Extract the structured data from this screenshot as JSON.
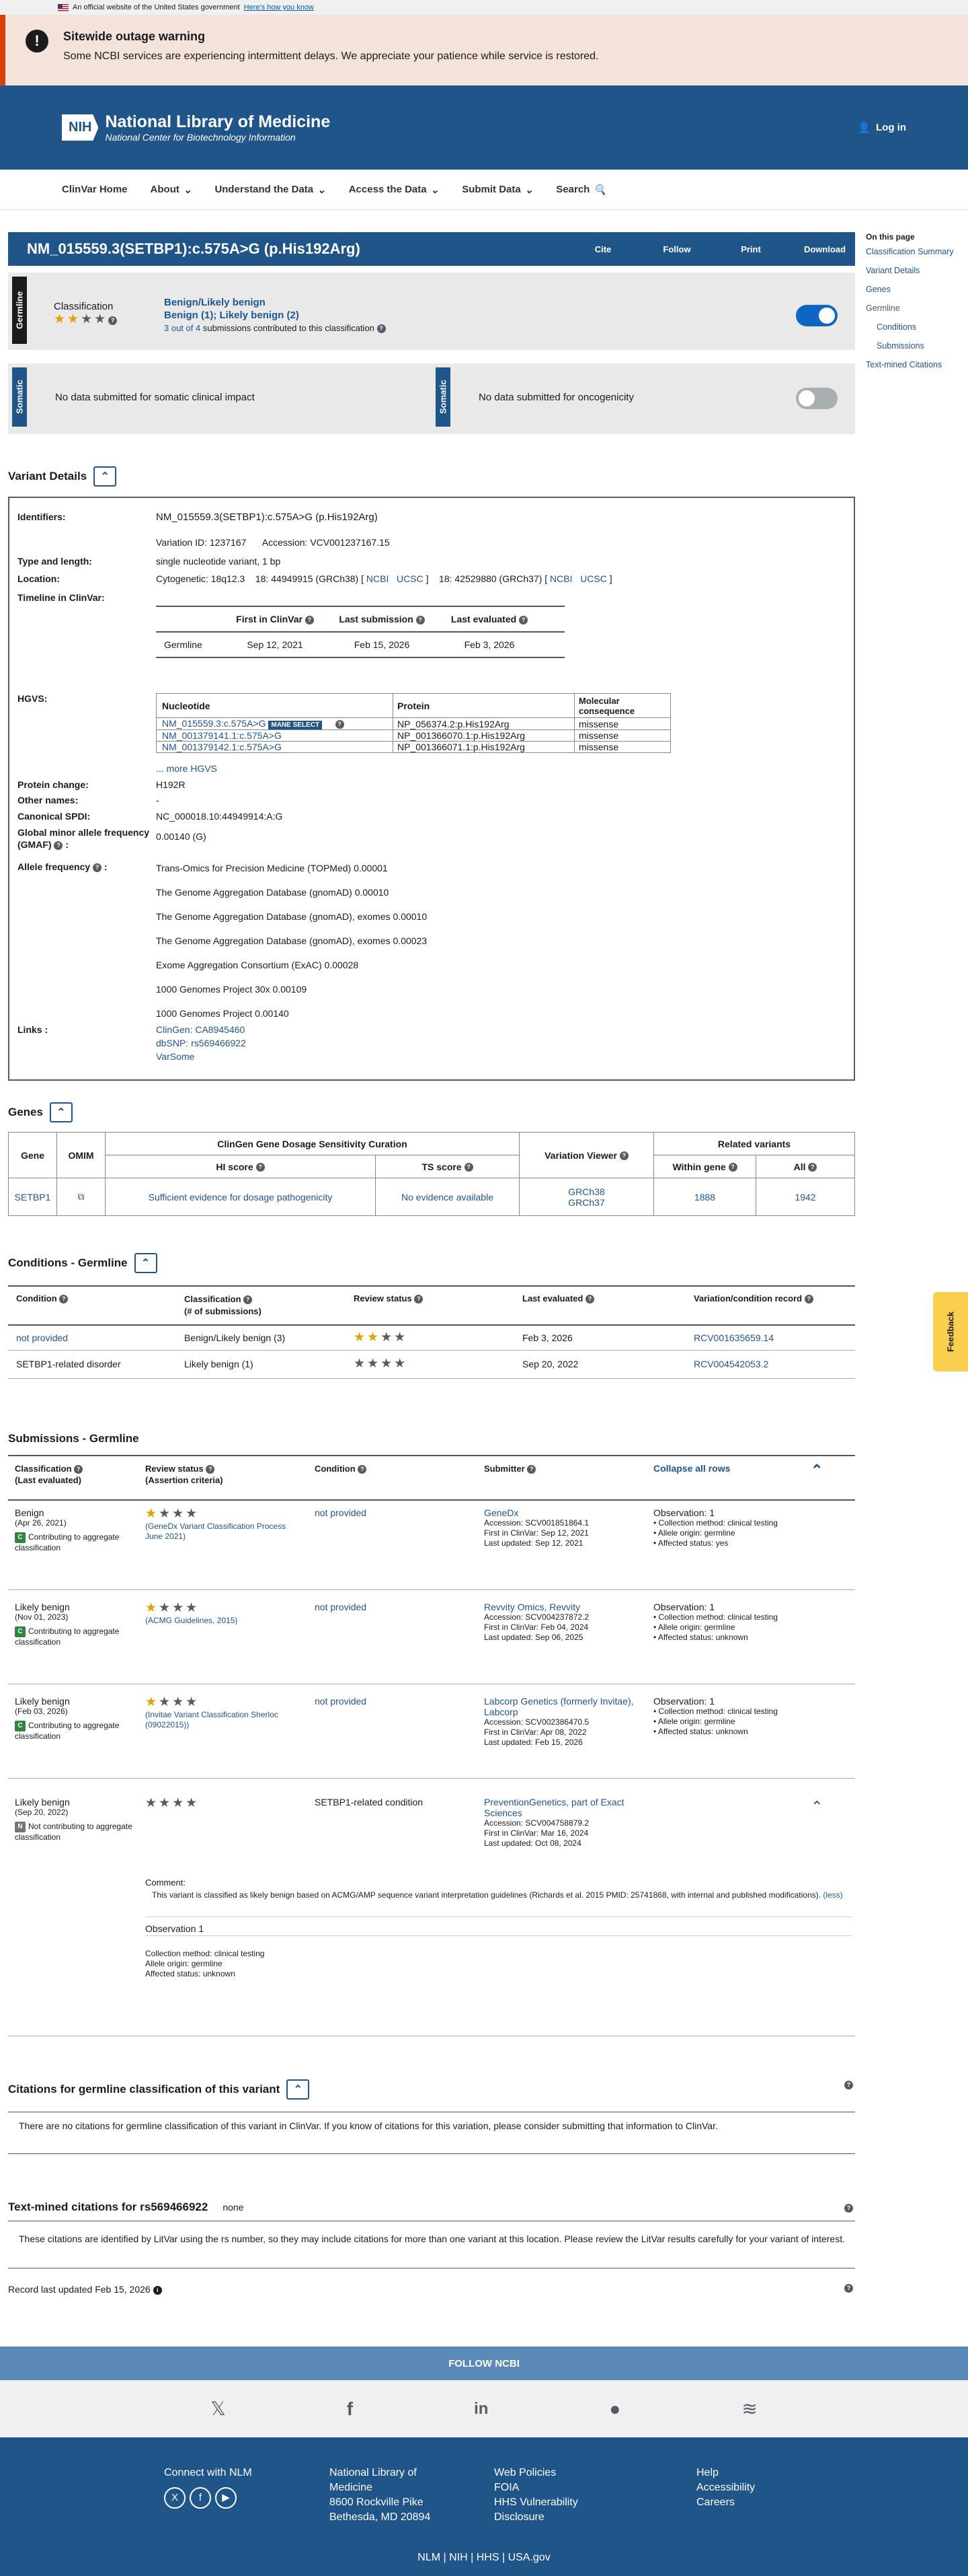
{
  "gov_banner": {
    "text": "An official website of the United States government",
    "link": "Here's how you know"
  },
  "alert": {
    "title": "Sitewide outage warning",
    "body": "Some NCBI services are experiencing intermittent delays. We appreciate your patience while service is restored."
  },
  "header": {
    "brand": "NIH",
    "title": "National Library of Medicine",
    "subtitle": "National Center for Biotechnology Information",
    "login": "Log in"
  },
  "nav": [
    "ClinVar Home",
    "About",
    "Understand the Data",
    "Access the Data",
    "Submit Data",
    "Search"
  ],
  "page": {
    "title": "NM_015559.3(SETBP1):c.575A>G (p.His192Arg)",
    "actions": [
      "Cite",
      "Follow",
      "Print",
      "Download"
    ]
  },
  "toc": {
    "heading": "On this page",
    "items": [
      "Classification Summary",
      "Variant Details",
      "Genes",
      "Germline",
      "Conditions",
      "Submissions",
      "Text-mined Citations"
    ]
  },
  "germline": {
    "tab": "Germline",
    "label": "Classification",
    "stars_filled": 2,
    "stars_total": 4,
    "classification": "Benign/Likely benign",
    "detail": "Benign (1); Likely benign (2)",
    "subs": "3 out of 4",
    "subs_rest": "submissions contributed to this classification",
    "toggle": "on"
  },
  "somatic": {
    "tab": "Somatic",
    "clinical": "No data submitted for somatic clinical impact",
    "onco": "No data submitted for oncogenicity",
    "toggle": "off"
  },
  "variant": {
    "section": "Variant Details",
    "identifiers_label": "Identifiers:",
    "identifier": "NM_015559.3(SETBP1):c.575A>G (p.His192Arg)",
    "variation_id": "Variation ID: 1237167",
    "accession": "Accession: VCV001237167.15",
    "type_label": "Type and length:",
    "type": "single nucleotide variant, 1 bp",
    "location_label": "Location:",
    "cyto": "Cytogenetic: 18q12.3",
    "loc38": "18: 44949915 (GRCh38) [",
    "loc37": "18: 42529880 (GRCh37) [",
    "ncbi": "NCBI",
    "ucsc": "UCSC",
    "close": "]",
    "timeline_label": "Timeline in ClinVar:",
    "tl_headers": [
      "First in ClinVar",
      "Last submission",
      "Last evaluated"
    ],
    "tl_row": [
      "Germline",
      "Sep 12, 2021",
      "Feb 15, 2026",
      "Feb 3, 2026"
    ],
    "hgvs_label": "HGVS:",
    "hgvs_headers": [
      "Nucleotide",
      "Protein",
      "Molecular consequence"
    ],
    "hgvs_rows": [
      [
        "NM_015559.3:c.575A>G",
        "NP_056374.2:p.His192Arg",
        "missense"
      ],
      [
        "NM_001379141.1:c.575A>G",
        "NP_001366070.1:p.His192Arg",
        "missense"
      ],
      [
        "NM_001379142.1:c.575A>G",
        "NP_001366071.1:p.His192Arg",
        "missense"
      ]
    ],
    "mane": "MANE SELECT",
    "more_hgvs": "... more HGVS",
    "protein_label": "Protein change:",
    "protein": "H192R",
    "other_label": "Other names:",
    "other": "-",
    "spdi_label": "Canonical SPDI:",
    "spdi": "NC_000018.10:44949914:A:G",
    "gmaf_label": "Global minor allele frequency (GMAF)",
    "gmaf": "0.00140 (G)",
    "af_label": "Allele frequency",
    "af": [
      "Trans-Omics for Precision Medicine (TOPMed) 0.00001",
      "The Genome Aggregation Database (gnomAD) 0.00010",
      "The Genome Aggregation Database (gnomAD), exomes 0.00010",
      "The Genome Aggregation Database (gnomAD), exomes 0.00023",
      "Exome Aggregation Consortium (ExAC) 0.00028",
      "1000 Genomes Project 30x 0.00109",
      "1000 Genomes Project 0.00140"
    ],
    "links_label": "Links :",
    "links": [
      "ClinGen: CA8945460",
      "dbSNP: rs569466922",
      "VarSome"
    ]
  },
  "genes": {
    "section": "Genes",
    "group_header": "ClinGen Gene Dosage Sensitivity Curation",
    "related": "Related variants",
    "cols": [
      "Gene",
      "OMIM",
      "HI score",
      "TS score",
      "Variation Viewer",
      "Within gene",
      "All"
    ],
    "row": {
      "gene": "SETBP1",
      "hi": "Sufficient evidence for dosage pathogenicity",
      "ts": "No evidence available",
      "vv1": "GRCh38",
      "vv2": "GRCh37",
      "within": "1888",
      "all": "1942"
    }
  },
  "conditions": {
    "section": "Conditions - Germline",
    "cols": [
      "Condition",
      "Classification",
      "(# of submissions)",
      "Review status",
      "Last evaluated",
      "Variation/condition record"
    ],
    "rows": [
      {
        "cond": "not provided",
        "cls": "Benign/Likely benign (3)",
        "stars": 2,
        "date": "Feb 3, 2026",
        "rcv": "RCV001635659.14"
      },
      {
        "cond": "SETBP1-related disorder",
        "cls": "Likely benign (1)",
        "stars": 0,
        "date": "Sep 20, 2022",
        "rcv": "RCV004542053.2"
      }
    ]
  },
  "submissions": {
    "section": "Submissions - Germline",
    "cols": [
      "Classification",
      "(Last evaluated)",
      "Review status",
      "(Assertion criteria)",
      "Condition",
      "Submitter",
      "Collapse all rows"
    ],
    "rows": [
      {
        "cls": "Benign",
        "date": "(Apr 26, 2021)",
        "contrib": "Contributing to aggregate classification",
        "badge": "C",
        "stars": 1,
        "crit": "(GeneDx Variant Classification Process June 2021)",
        "cond": "not provided",
        "sub": "GeneDx",
        "acc": "Accession: SCV001851864.1",
        "first": "First in ClinVar: Sep 12, 2021",
        "last": "Last updated: Sep 12, 2021",
        "obs": "Observation: 1",
        "b1": "Collection method: clinical testing",
        "b2": "Allele origin: germline",
        "b3": "Affected status: yes"
      },
      {
        "cls": "Likely benign",
        "date": "(Nov 01, 2023)",
        "contrib": "Contributing to aggregate classification",
        "badge": "C",
        "stars": 1,
        "crit": "(ACMG Guidelines, 2015)",
        "cond": "not provided",
        "sub": "Revvity Omics, Revvity",
        "acc": "Accession: SCV004237872.2",
        "first": "First in ClinVar: Feb 04, 2024",
        "last": "Last updated: Sep 06, 2025",
        "obs": "Observation: 1",
        "b1": "Collection method: clinical testing",
        "b2": "Allele origin: germline",
        "b3": "Affected status: unknown"
      },
      {
        "cls": "Likely benign",
        "date": "(Feb 03, 2026)",
        "contrib": "Contributing to aggregate classification",
        "badge": "C",
        "stars": 1,
        "crit": "(Invitae Variant Classification Sherloc (09022015))",
        "cond": "not provided",
        "sub": "Labcorp Genetics (formerly Invitae), Labcorp",
        "acc": "Accession: SCV002386470.5",
        "first": "First in ClinVar: Apr 08, 2022",
        "last": "Last updated: Feb 15, 2026",
        "obs": "Observation: 1",
        "b1": "Collection method: clinical testing",
        "b2": "Allele origin: germline",
        "b3": "Affected status: unknown"
      },
      {
        "cls": "Likely benign",
        "date": "(Sep 20, 2022)",
        "contrib": "Not contributing to aggregate classification",
        "badge": "N",
        "stars": 0,
        "crit": "",
        "cond": "SETBP1-related condition",
        "sub": "PreventionGenetics, part of Exact Sciences",
        "acc": "Accession: SCV004758879.2",
        "first": "First in ClinVar: Mar 16, 2024",
        "last": "Last updated: Oct 08, 2024",
        "obs": "",
        "b1": "",
        "b2": "",
        "b3": ""
      }
    ],
    "comment_label": "Comment:",
    "comment": "This variant is classified as likely benign based on ACMG/AMP sequence variant interpretation guidelines (Richards et al. 2015 PMID: 25741868, with internal and published modifications).",
    "less": "(less)",
    "obs_title": "Observation 1",
    "obs_lines": [
      "Collection method: clinical testing",
      "Allele origin: germline",
      "Affected status: unknown"
    ]
  },
  "citations": {
    "section": "Citations for germline classification of this variant",
    "text": "There are no citations for germline classification of this variant in ClinVar. If you know of citations for this variation, please consider submitting that information to ClinVar."
  },
  "textmined": {
    "section": "Text-mined citations for rs569466922",
    "none": "none",
    "text": "These citations are identified by LitVar using the rs number, so they may include citations for more than one variant at this location. Please review the LitVar results carefully for your variant of interest."
  },
  "record": "Record last updated Feb 15, 2026",
  "feedback": "Feedback",
  "footer": {
    "follow": "FOLLOW NCBI",
    "connect": "Connect with NLM",
    "addr": [
      "National Library of",
      "Medicine",
      "8600 Rockville Pike",
      "Bethesda, MD 20894"
    ],
    "col3": [
      "Web Policies",
      "FOIA",
      "HHS Vulnerability",
      "Disclosure"
    ],
    "col4": [
      "Help",
      "Accessibility",
      "Careers"
    ],
    "bottom": [
      "NLM",
      "NIH",
      "HHS",
      "USA.gov"
    ]
  }
}
